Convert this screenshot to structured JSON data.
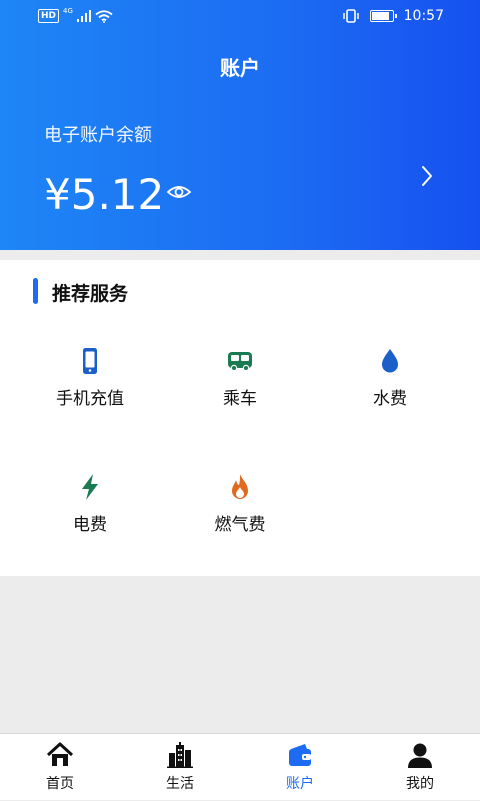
{
  "status_bar": {
    "left_badge": "HD",
    "network": "4G",
    "time": "10:57",
    "battery_level": 0.85
  },
  "header": {
    "title": "账户",
    "balance_label": "电子账户余额",
    "balance_amount": "¥5.12"
  },
  "services": {
    "section_title": "推荐服务",
    "items": [
      {
        "label": "手机充值",
        "icon": "phone-icon",
        "color": "#1b5fc9"
      },
      {
        "label": "乘车",
        "icon": "bus-icon",
        "color": "#1a7a52"
      },
      {
        "label": "水费",
        "icon": "water-drop-icon",
        "color": "#1b5fc9"
      },
      {
        "label": "电费",
        "icon": "lightning-icon",
        "color": "#1a7a52"
      },
      {
        "label": "燃气费",
        "icon": "flame-icon",
        "color": "#e06a1e"
      }
    ]
  },
  "tabbar": {
    "tabs": [
      {
        "label": "首页",
        "icon": "home-icon"
      },
      {
        "label": "生活",
        "icon": "city-icon"
      },
      {
        "label": "账户",
        "icon": "wallet-icon",
        "active": true
      },
      {
        "label": "我的",
        "icon": "user-icon"
      }
    ],
    "accent": "#1c6bf2"
  }
}
